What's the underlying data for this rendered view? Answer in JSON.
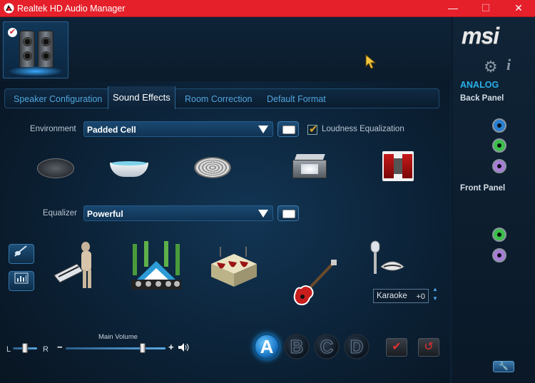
{
  "window": {
    "title": "Realtek HD Audio Manager",
    "min_glyph": "—",
    "max_glyph": "☐",
    "close_glyph": "✕"
  },
  "tabs": [
    {
      "label": "Speaker Configuration",
      "active": false
    },
    {
      "label": "Sound Effects",
      "active": true
    },
    {
      "label": "Room Correction",
      "active": false
    },
    {
      "label": "Default Format",
      "active": false
    }
  ],
  "environment": {
    "label": "Environment",
    "value": "Padded Cell",
    "loudness_label": "Loudness Equalization",
    "loudness_checked": true,
    "icons": [
      "sewer-pipe-icon",
      "bathtub-icon",
      "stone-room-icon",
      "room-box-icon",
      "theater-stage-icon"
    ]
  },
  "equalizer": {
    "label": "Equalizer",
    "value": "Powerful",
    "presets": [
      "pop-icon",
      "live-concert-icon",
      "club-icon",
      "rock-guitar-icon",
      "karaoke-icon"
    ]
  },
  "karaoke": {
    "label": "Karaoke",
    "value": "+0"
  },
  "balance": {
    "left": "L",
    "right": "R",
    "level": 0.5
  },
  "main_volume": {
    "label": "Main Volume",
    "minus": "−",
    "plus": "+",
    "level": 0.75
  },
  "profiles": [
    {
      "label": "A",
      "active": true
    },
    {
      "label": "B",
      "active": false
    },
    {
      "label": "C",
      "active": false
    },
    {
      "label": "D",
      "active": false
    }
  ],
  "side_panel": {
    "brand": "msi",
    "analog_label": "ANALOG",
    "back_panel_label": "Back Panel",
    "front_panel_label": "Front Panel",
    "back_jacks": [
      {
        "color": "#2a7fd1"
      },
      {
        "color": "#3cc04a"
      },
      {
        "color": "#a77cd6"
      }
    ],
    "front_jacks": [
      {
        "color": "#3cc04a"
      },
      {
        "color": "#a77cd6"
      }
    ]
  },
  "colors": {
    "titlebar": "#e5202b",
    "accent": "#2ab0e8",
    "tab_text": "#4fa6e0"
  }
}
